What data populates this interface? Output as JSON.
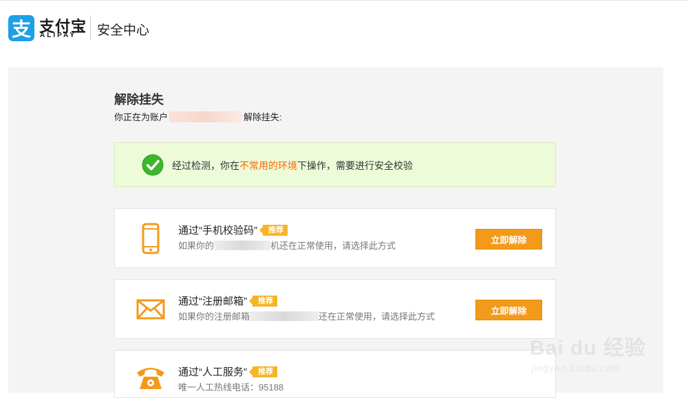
{
  "header": {
    "logo_mark": "支",
    "logo_cn": "支付宝",
    "logo_en": "ALIPAY",
    "title": "安全中心"
  },
  "page": {
    "title": "解除挂失",
    "account_prefix": "你正在为账户",
    "account_suffix": "解除挂失:"
  },
  "notice": {
    "text_before": "经过检测，你在",
    "text_highlight": "不常用的环境",
    "text_after": "下操作，需要进行安全校验",
    "highlight_color": "#ff6600"
  },
  "options": [
    {
      "icon": "mobile-phone-icon",
      "title": "通过“手机校验码”",
      "badge": "推荐",
      "desc_before": "如果你的",
      "desc_after": "机还在正常使用，请选择此方式",
      "button": "立即解除"
    },
    {
      "icon": "envelope-icon",
      "title": "通过“注册邮箱”",
      "badge": "推荐",
      "desc_before": "如果你的注册邮箱",
      "desc_after": "还在正常使用，请选择此方式",
      "button": "立即解除"
    },
    {
      "icon": "telephone-icon",
      "title": "通过“人工服务”",
      "badge": "推荐",
      "desc": "唯一人工热线电话：95188"
    }
  ],
  "watermark": {
    "text": "Bai du 经验",
    "url": "jingyan.baidu.com"
  },
  "colors": {
    "brand_blue": "#1e9fe6",
    "accent_orange": "#f39a1a",
    "badge_yellow": "#f6b426",
    "notice_bg": "#edfbd9",
    "success_green": "#3fb42e"
  }
}
